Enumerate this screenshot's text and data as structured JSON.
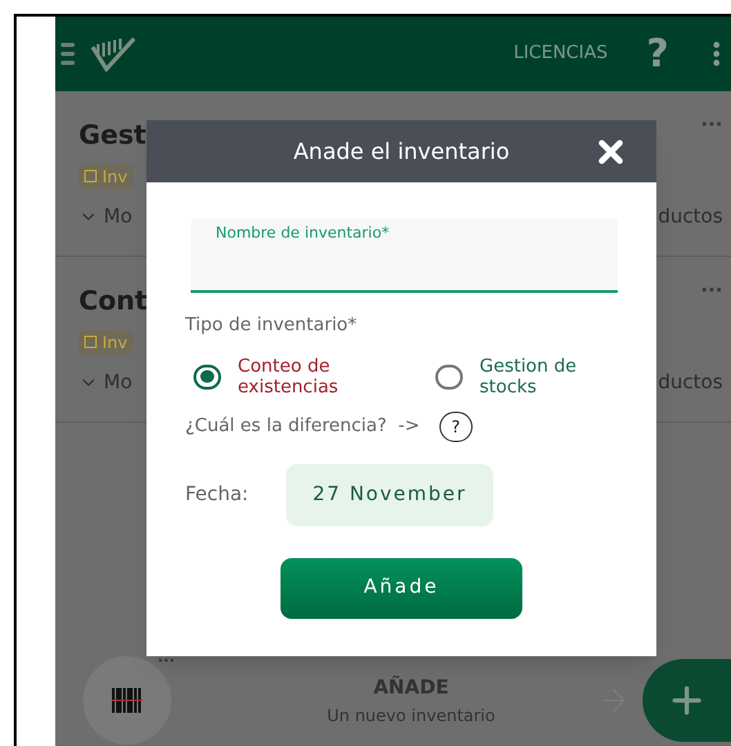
{
  "app_bar": {
    "licenses": "LICENCIAS",
    "help": "?"
  },
  "inventories": [
    {
      "title": "Gest",
      "badge": "Inv",
      "toggle": "Mo",
      "count": "ductos",
      "menu": "..."
    },
    {
      "title": "Cont",
      "badge": "Inv",
      "toggle": "Mo",
      "count": "ductos",
      "menu": "..."
    }
  ],
  "dialog": {
    "title": "Anade el inventario",
    "name_field": {
      "label": "Nombre de inventario*"
    },
    "type_label": "Tipo de inventario*",
    "types": [
      {
        "label": "Conteo de existencias",
        "selected": true
      },
      {
        "label": "Gestion de stocks",
        "selected": false
      }
    ],
    "difference": "¿Cuál es la diferencia?  ->",
    "help": "?",
    "date_label": "Fecha:",
    "date": "27 November",
    "submit": "Añade"
  },
  "bottom_bar": {
    "scan_menu": "...",
    "title": "AÑADE",
    "subtitle": "Un nuevo inventario"
  }
}
